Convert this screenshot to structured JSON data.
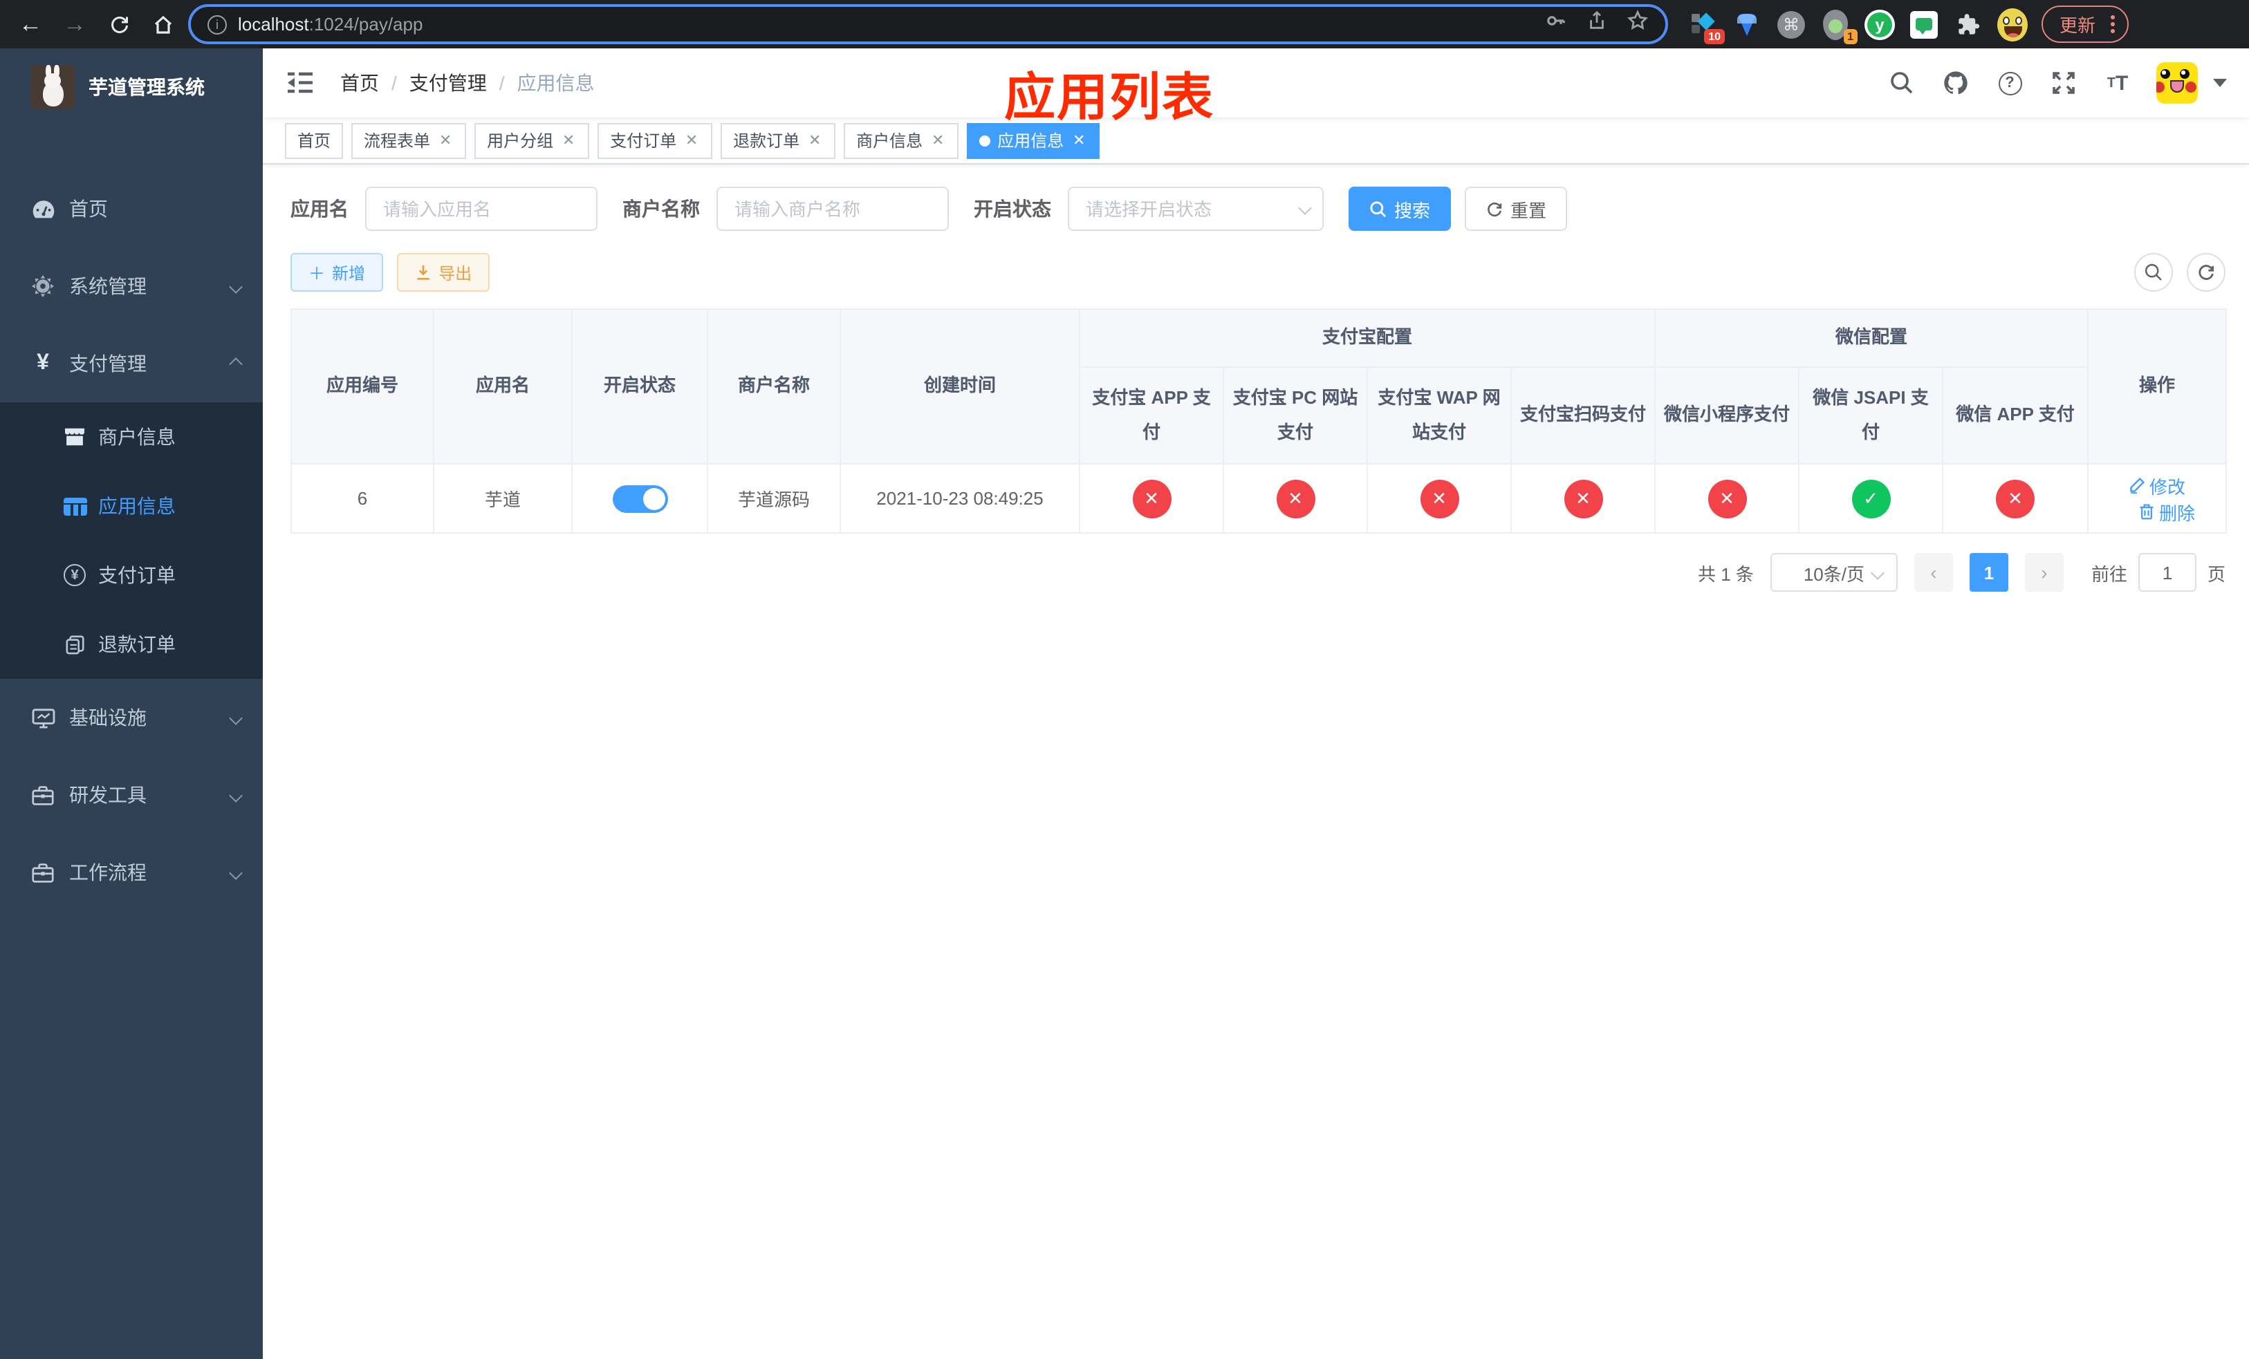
{
  "browser": {
    "url": {
      "host": "localhost",
      "rest": ":1024/pay/app"
    },
    "update_button": "更新",
    "ext_badge_blocks": "10",
    "ext_badge_avocado": "1"
  },
  "sidebar": {
    "title": "芋道管理系统",
    "menu": [
      {
        "label": "首页"
      },
      {
        "label": "系统管理"
      },
      {
        "label": "支付管理"
      },
      {
        "label": "基础设施"
      },
      {
        "label": "研发工具"
      },
      {
        "label": "工作流程"
      }
    ],
    "submenu": [
      {
        "label": "商户信息"
      },
      {
        "label": "应用信息"
      },
      {
        "label": "支付订单"
      },
      {
        "label": "退款订单"
      }
    ]
  },
  "navbar": {
    "breadcrumb": [
      "首页",
      "支付管理",
      "应用信息"
    ],
    "annotation": "应用列表"
  },
  "tabs": [
    {
      "label": "首页",
      "closable": false,
      "active": false
    },
    {
      "label": "流程表单",
      "closable": true,
      "active": false
    },
    {
      "label": "用户分组",
      "closable": true,
      "active": false
    },
    {
      "label": "支付订单",
      "closable": true,
      "active": false
    },
    {
      "label": "退款订单",
      "closable": true,
      "active": false
    },
    {
      "label": "商户信息",
      "closable": true,
      "active": false
    },
    {
      "label": "应用信息",
      "closable": true,
      "active": true
    }
  ],
  "filters": {
    "app_name": {
      "label": "应用名",
      "placeholder": "请输入应用名"
    },
    "merchant_name": {
      "label": "商户名称",
      "placeholder": "请输入商户名称"
    },
    "status": {
      "label": "开启状态",
      "placeholder": "请选择开启状态"
    },
    "search": "搜索",
    "reset": "重置"
  },
  "toolbar": {
    "add": "新增",
    "export": "导出"
  },
  "table": {
    "columns": [
      "应用编号",
      "应用名",
      "开启状态",
      "商户名称",
      "创建时间"
    ],
    "groups": {
      "alipay": "支付宝配置",
      "wechat": "微信配置"
    },
    "channel_columns": [
      "支付宝 APP 支付",
      "支付宝 PC 网站支付",
      "支付宝 WAP 网站支付",
      "支付宝扫码支付",
      "微信小程序支付",
      "微信 JSAPI 支付",
      "微信 APP 支付"
    ],
    "ops_column": "操作",
    "row": {
      "id": "6",
      "name": "芋道",
      "enabled": true,
      "merchant": "芋道源码",
      "created": "2021-10-23 08:49:25",
      "channels": [
        "no",
        "no",
        "no",
        "no",
        "no",
        "yes",
        "no"
      ],
      "ops": {
        "edit": "修改",
        "delete": "删除"
      }
    }
  },
  "pagination": {
    "total": "共 1 条",
    "page_size": "10条/页",
    "page": "1",
    "goto": "前往",
    "goto_value": "1",
    "unit": "页"
  },
  "colors": {
    "primary": "#409eff",
    "danger": "#f3434a",
    "success": "#10c45e",
    "annotation": "#ff2b00",
    "sidebar": "#304156",
    "submenu": "#1f2d3d"
  }
}
